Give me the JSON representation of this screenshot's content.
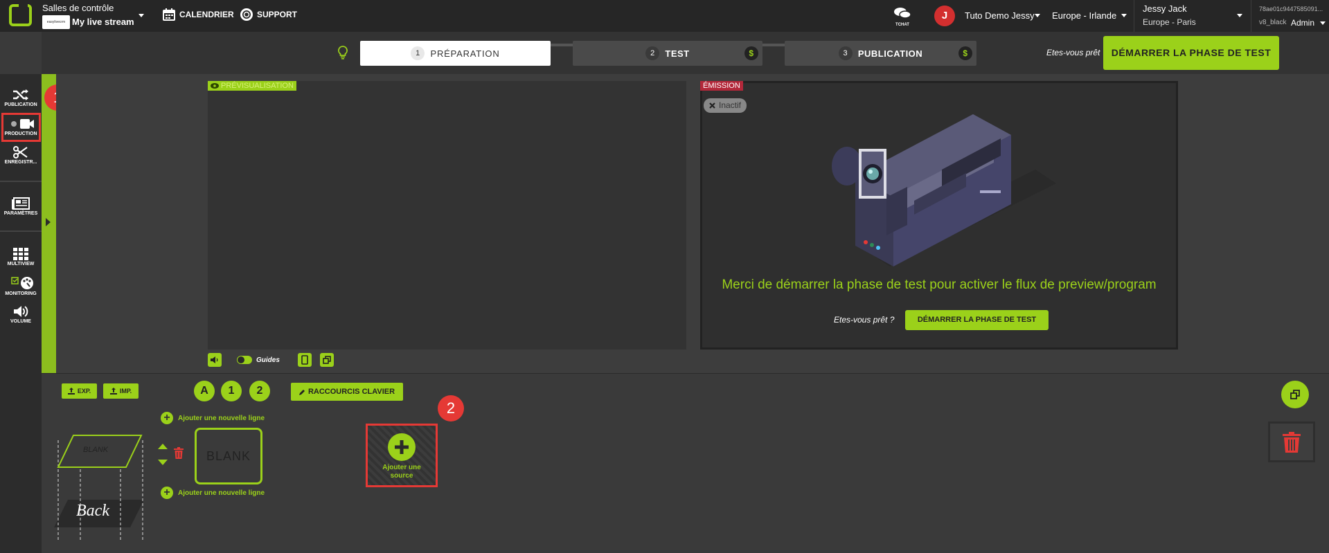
{
  "topbar": {
    "rooms_label": "Salles de contrôle",
    "stream_name": "My live stream",
    "stream_logo_text": "easylivecrm",
    "calendar": "CALENDRIER",
    "support": "SUPPORT",
    "tchat": "TCHAT",
    "avatar_letter": "J",
    "account": "Tuto Demo Jessy",
    "region": "Europe - Irlande",
    "user_name": "Jessy Jack",
    "user_tz": "Europe - Paris",
    "session_id": "78ae01c9447585091...",
    "theme": "v8_black",
    "role": "Admin"
  },
  "phases": {
    "items": [
      {
        "num": "1",
        "label": "PRÉPARATION"
      },
      {
        "num": "2",
        "label": "TEST"
      },
      {
        "num": "3",
        "label": "PUBLICATION"
      }
    ],
    "dollar": "$",
    "ready_question": "Etes-vous prêt",
    "start_button": "DÉMARRER LA PHASE DE TEST"
  },
  "sidebar": {
    "items": [
      {
        "label": "PUBLICATION",
        "icon": "shuffle-icon"
      },
      {
        "label": "PRODUCTION",
        "icon": "video-camera-icon"
      },
      {
        "label": "ENREGISTR...",
        "icon": "scissors-icon"
      },
      {
        "label": "PARAMÈTRES",
        "icon": "newspaper-icon"
      },
      {
        "label": "MULTIVIEW",
        "icon": "grid-icon"
      },
      {
        "label": "MONITORING",
        "icon": "palette-icon"
      },
      {
        "label": "VOLUME",
        "icon": "volume-icon"
      }
    ]
  },
  "preview": {
    "label": "PRÉVISUALISATION",
    "guides": "Guides"
  },
  "emission": {
    "label": "ÉMISSION",
    "status": "Inactif",
    "message": "Merci de démarrer la phase de test pour activer le flux de preview/program",
    "ready_question": "Etes-vous prêt ?",
    "start_button": "DÉMARRER LA PHASE DE TEST"
  },
  "annotations": {
    "one": "1",
    "two": "2"
  },
  "bottom": {
    "export": "EXP.",
    "import": "IMP.",
    "layers": [
      "A",
      "1",
      "2"
    ],
    "shortcuts": "RACCOURCIS CLAVIER",
    "add_line": "Ajouter une nouvelle ligne",
    "blank_small": "BLANK",
    "blank": "BLANK",
    "back": "Back",
    "add_source_line1": "Ajouter une",
    "add_source_line2": "source"
  },
  "colors": {
    "accent": "#9bd11a",
    "danger": "#e53935",
    "background": "#3a3a3a"
  }
}
